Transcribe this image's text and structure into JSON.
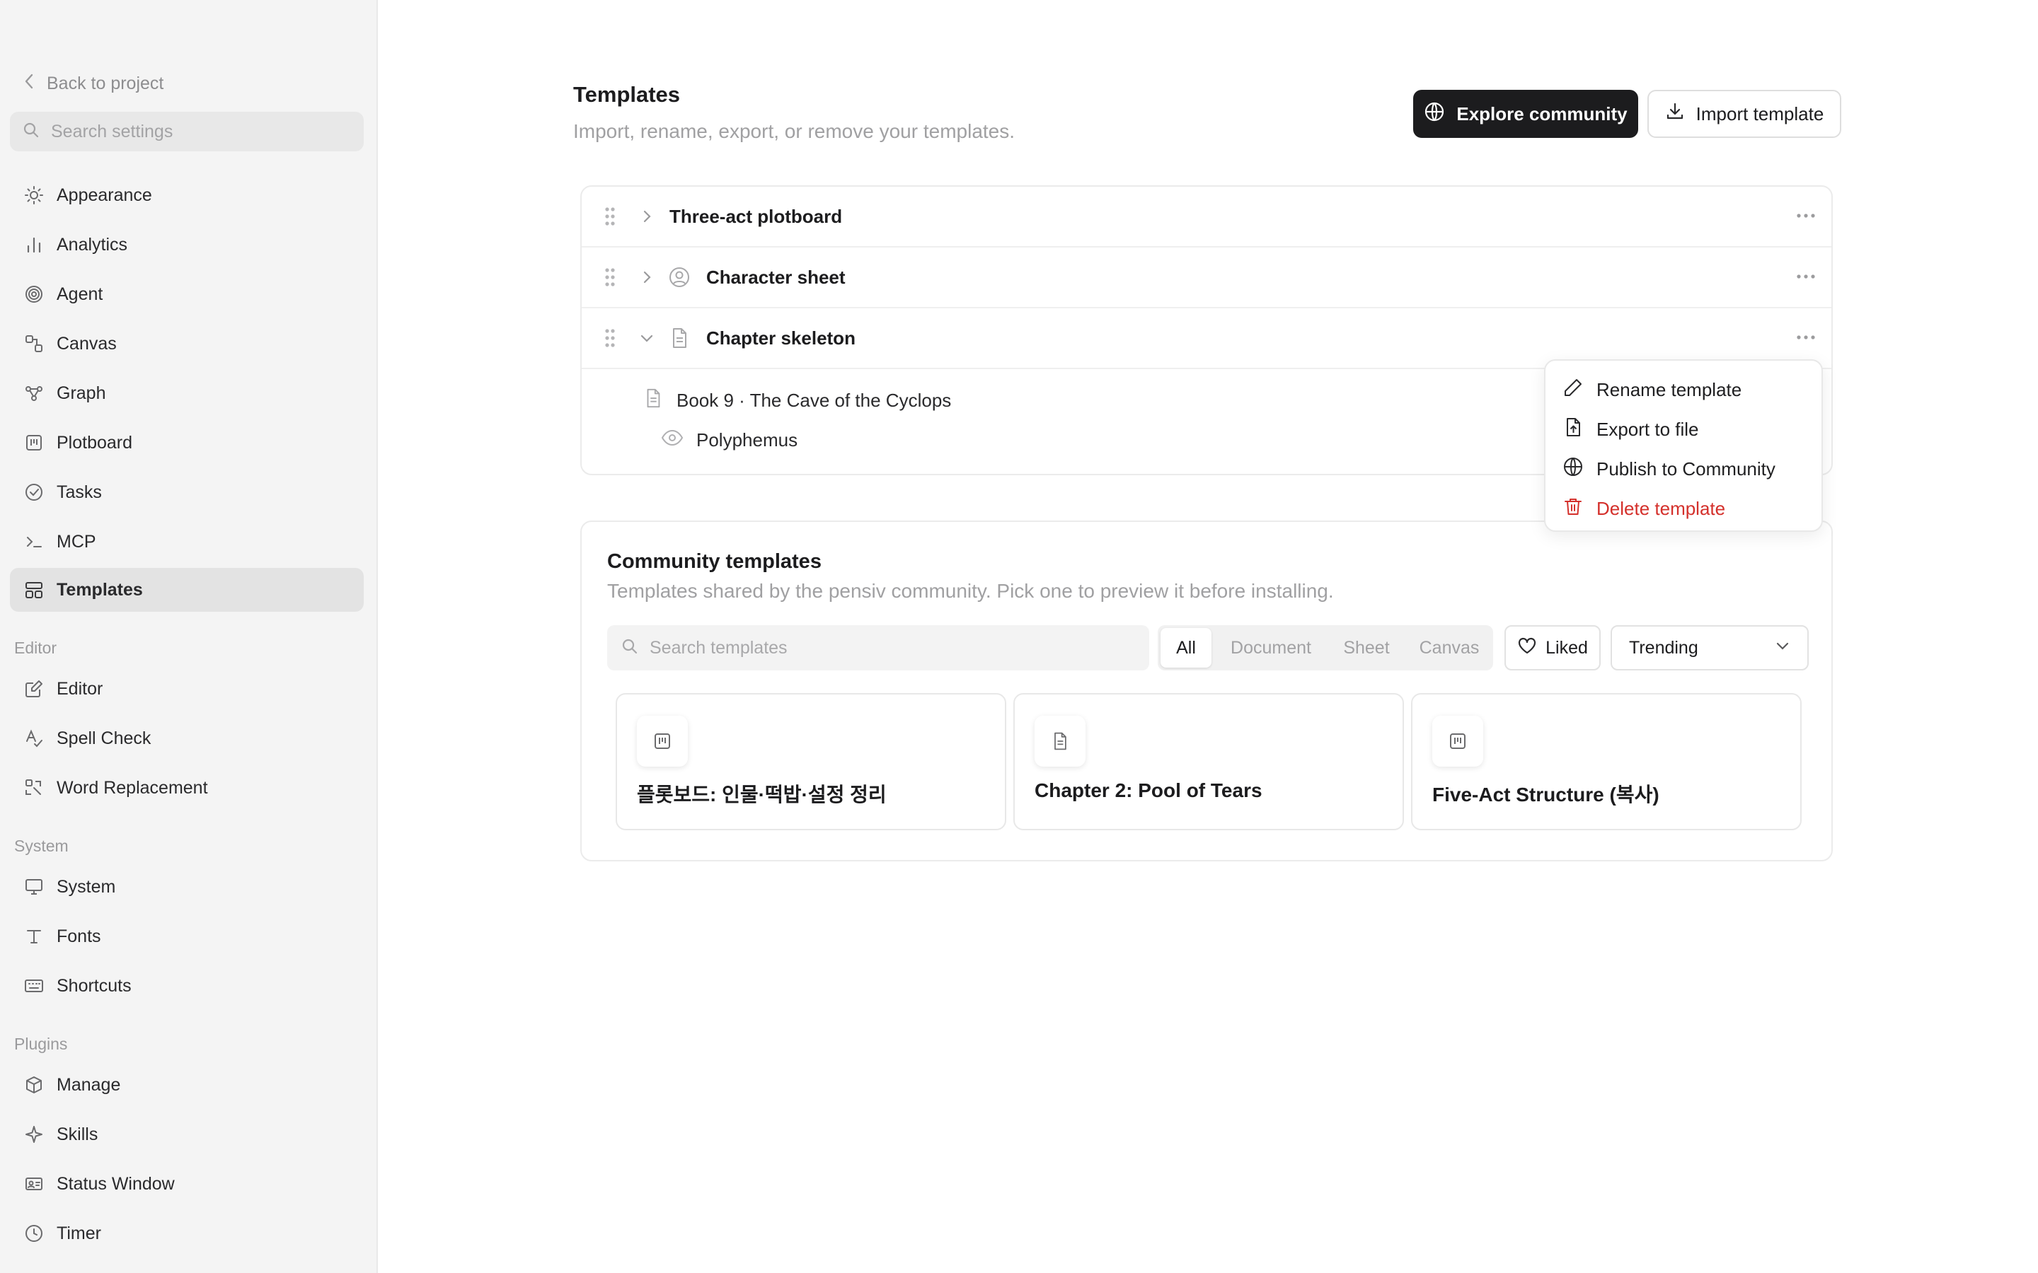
{
  "sidebar": {
    "back_label": "Back to project",
    "search_placeholder": "Search settings",
    "items": [
      {
        "label": "Appearance",
        "icon": "sun-icon"
      },
      {
        "label": "Analytics",
        "icon": "bar-chart-icon"
      },
      {
        "label": "Agent",
        "icon": "spiral-icon"
      },
      {
        "label": "Canvas",
        "icon": "canvas-icon"
      },
      {
        "label": "Graph",
        "icon": "graph-icon"
      },
      {
        "label": "Plotboard",
        "icon": "plotboard-icon"
      },
      {
        "label": "Tasks",
        "icon": "check-circle-icon"
      },
      {
        "label": "MCP",
        "icon": "terminal-icon"
      },
      {
        "label": "Templates",
        "icon": "templates-icon",
        "active": true
      }
    ],
    "editor_section": "Editor",
    "editor_items": [
      {
        "label": "Editor",
        "icon": "edit-icon"
      },
      {
        "label": "Spell Check",
        "icon": "spell-check-icon"
      },
      {
        "label": "Word Replacement",
        "icon": "replace-icon"
      }
    ],
    "system_section": "System",
    "system_items": [
      {
        "label": "System",
        "icon": "monitor-icon"
      },
      {
        "label": "Fonts",
        "icon": "type-icon"
      },
      {
        "label": "Shortcuts",
        "icon": "keyboard-icon"
      }
    ],
    "plugins_section": "Plugins",
    "plugins_items": [
      {
        "label": "Manage",
        "icon": "package-icon"
      },
      {
        "label": "Skills",
        "icon": "sparkle-icon"
      },
      {
        "label": "Status Window",
        "icon": "id-card-icon"
      },
      {
        "label": "Timer",
        "icon": "clock-icon"
      }
    ]
  },
  "main": {
    "title": "Templates",
    "subtitle": "Import, rename, export, or remove your templates.",
    "explore_label": "Explore community",
    "import_label": "Import template",
    "templates": [
      {
        "name": "Three-act plotboard",
        "expanded": false
      },
      {
        "name": "Character sheet",
        "expanded": false
      },
      {
        "name": "Chapter skeleton",
        "expanded": true
      }
    ],
    "children": [
      {
        "label": "Book 9 · The Cave of the Cyclops",
        "icon": "document-icon"
      },
      {
        "label": "Polyphemus",
        "icon": "eye-icon"
      }
    ],
    "context_menu": {
      "rename": "Rename template",
      "export": "Export to file",
      "publish": "Publish to Community",
      "delete": "Delete template"
    }
  },
  "community": {
    "title": "Community templates",
    "subtitle": "Templates shared by the pensiv community. Pick one to preview it before installing.",
    "search_placeholder": "Search templates",
    "filters": [
      "All",
      "Document",
      "Sheet",
      "Canvas"
    ],
    "active_filter": "All",
    "liked_label": "Liked",
    "sort_value": "Trending",
    "cards": [
      {
        "title": "플롯보드: 인물·떡밥·설정 정리",
        "icon": "plotboard-icon"
      },
      {
        "title": "Chapter 2: Pool of Tears",
        "icon": "document-icon"
      },
      {
        "title": "Five-Act Structure (복사)",
        "icon": "plotboard-icon"
      }
    ]
  },
  "colors": {
    "danger": "#d4302b",
    "primary_button": "#1c1c1e",
    "sidebar_bg": "#f4f4f4",
    "active_item_bg": "#e3e3e3"
  }
}
